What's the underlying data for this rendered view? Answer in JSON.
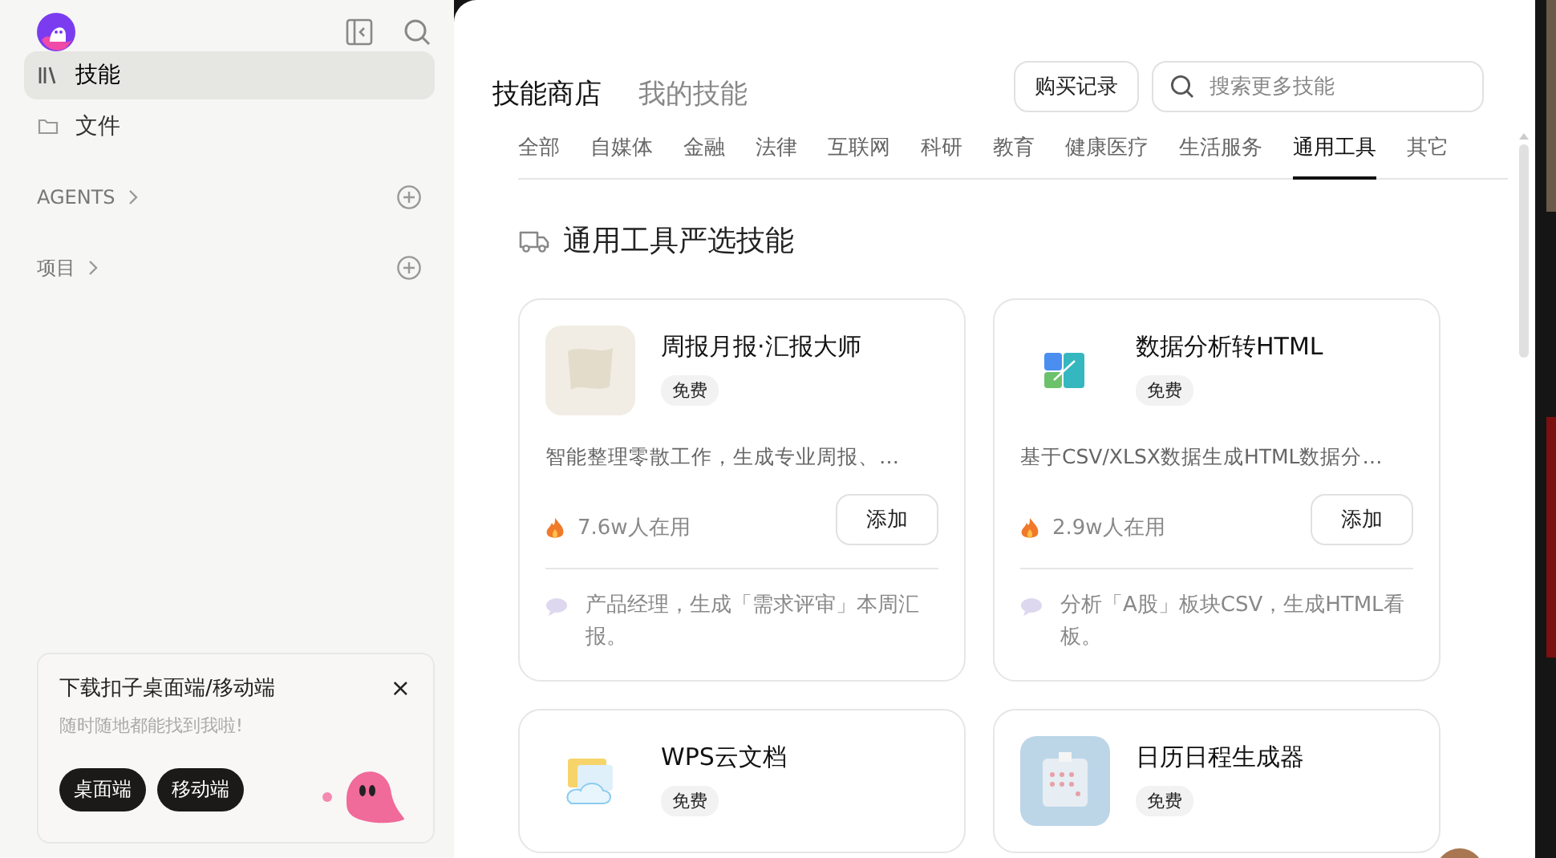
{
  "sidebar": {
    "nav": [
      {
        "label": "技能",
        "selected": true
      },
      {
        "label": "文件",
        "selected": false
      }
    ],
    "sections": [
      {
        "label": "AGENTS"
      },
      {
        "label": "项目"
      }
    ],
    "promo": {
      "title": "下载扣子桌面端/移动端",
      "subtitle": "随时随地都能找到我啦!",
      "close": "×",
      "buttons": [
        "桌面端",
        "移动端"
      ]
    }
  },
  "header": {
    "tabs": [
      {
        "label": "技能商店",
        "selected": true
      },
      {
        "label": "我的技能",
        "selected": false
      }
    ],
    "purchase_button": "购买记录",
    "search": {
      "placeholder": "搜索更多技能"
    }
  },
  "categories": [
    {
      "label": "全部",
      "selected": false
    },
    {
      "label": "自媒体",
      "selected": false
    },
    {
      "label": "金融",
      "selected": false
    },
    {
      "label": "法律",
      "selected": false
    },
    {
      "label": "互联网",
      "selected": false
    },
    {
      "label": "科研",
      "selected": false
    },
    {
      "label": "教育",
      "selected": false
    },
    {
      "label": "健康医疗",
      "selected": false
    },
    {
      "label": "生活服务",
      "selected": false
    },
    {
      "label": "通用工具",
      "selected": true
    },
    {
      "label": "其它",
      "selected": false
    }
  ],
  "section_title": "通用工具严选技能",
  "cards": [
    {
      "title": "周报月报·汇报大师",
      "price": "免费",
      "description": "智能整理零散工作，生成专业周报、…",
      "users": "7.6w人在用",
      "button": "添加",
      "example": "产品经理，生成「需求评审」本周汇报。"
    },
    {
      "title": "数据分析转HTML",
      "price": "免费",
      "description": "基于CSV/XLSX数据生成HTML数据分…",
      "users": "2.9w人在用",
      "button": "添加",
      "example": "分析「A股」板块CSV，生成HTML看板。"
    },
    {
      "title": "WPS云文档",
      "price": "免费"
    },
    {
      "title": "日历日程生成器",
      "price": "免费"
    }
  ]
}
